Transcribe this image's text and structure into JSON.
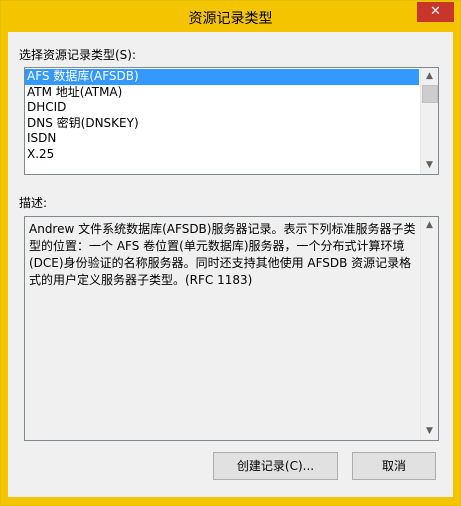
{
  "dialog": {
    "title": "资源记录类型",
    "close_glyph": "✕"
  },
  "select_label": "选择资源记录类型(S):",
  "record_types": [
    "AFS 数据库(AFSDB)",
    "ATM 地址(ATMA)",
    "DHCID",
    "DNS 密钥(DNSKEY)",
    "ISDN",
    "X.25"
  ],
  "selected_index": 0,
  "description_label": "描述:",
  "description_text": "Andrew 文件系统数据库(AFSDB)服务器记录。表示下列标准服务器子类型的位置：一个 AFS 卷位置(单元数据库)服务器，一个分布式计算环境(DCE)身份验证的名称服务器。同时还支持其他使用 AFSDB 资源记录格式的用户定义服务器子类型。(RFC 1183)",
  "buttons": {
    "create": "创建记录(C)...",
    "cancel": "取消"
  },
  "icons": {
    "scroll_up": "▲",
    "scroll_down": "▼"
  },
  "colors": {
    "title_bar": "#f5c400",
    "selection": "#3399ff",
    "close_button": "#c7352b"
  }
}
